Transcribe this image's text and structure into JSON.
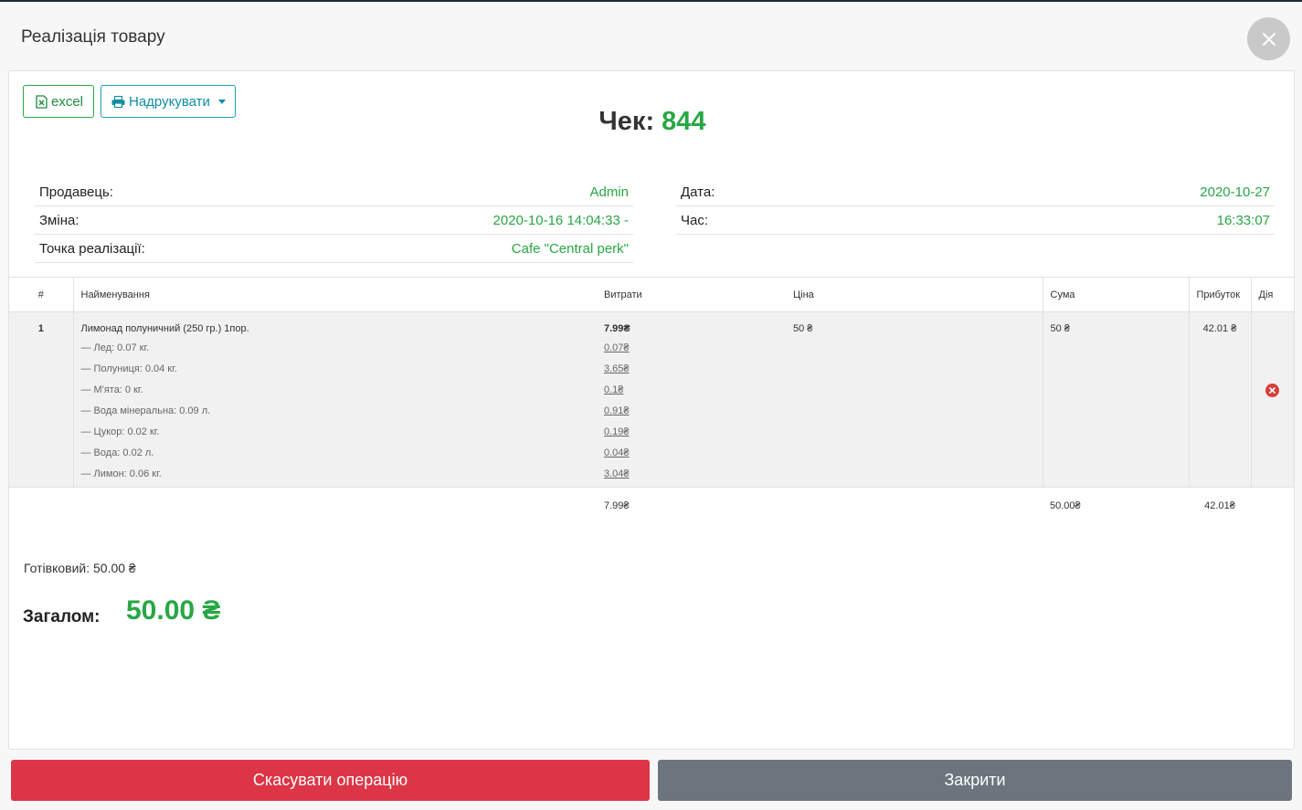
{
  "modal": {
    "title": "Реалізація товару"
  },
  "toolbar": {
    "excel_label": "excel",
    "print_label": "Надрукувати"
  },
  "receipt": {
    "label": "Чек:",
    "number": "844"
  },
  "info_left": [
    {
      "label": "Продавець:",
      "value": "Admin"
    },
    {
      "label": "Зміна:",
      "value": "2020-10-16 14:04:33 -"
    },
    {
      "label": "Точка реалізації:",
      "value": "Cafe \"Central perk\""
    }
  ],
  "info_right": [
    {
      "label": "Дата:",
      "value": "2020-10-27"
    },
    {
      "label": "Час:",
      "value": "16:33:07"
    }
  ],
  "table": {
    "headers": [
      "#",
      "Найменування",
      "Витрати",
      "Ціна",
      "Сума",
      "Прибуток",
      "Дія"
    ],
    "rows": [
      {
        "index": "1",
        "name": "Лимонад полуничний (250 гр.) 1пор.",
        "cost": "7.99₴",
        "price": "50 ₴",
        "sum": "50 ₴",
        "profit": "42.01 ₴",
        "ingredients": [
          {
            "name": "— Лед: 0.07 кг.",
            "cost": "0.07₴"
          },
          {
            "name": "— Полуниця: 0.04 кг.",
            "cost": "3.65₴"
          },
          {
            "name": "— М'ята: 0 кг.",
            "cost": "0.1₴"
          },
          {
            "name": "— Вода мінеральна: 0.09 л.",
            "cost": "0.91₴"
          },
          {
            "name": "— Цукор: 0.02 кг.",
            "cost": "0.19₴"
          },
          {
            "name": "— Вода: 0.02 л.",
            "cost": "0.04₴"
          },
          {
            "name": "— Лимон: 0.06 кг.",
            "cost": "3.04₴"
          }
        ]
      }
    ],
    "totals": {
      "cost": "7.99₴",
      "sum": "50.00₴",
      "profit": "42.01₴"
    }
  },
  "payment": {
    "cash": "Готівковий: 50.00 ₴"
  },
  "total": {
    "label": "Загалом:",
    "value": "50.00 ₴"
  },
  "footer": {
    "cancel_label": "Скасувати операцію",
    "close_label": "Закрити"
  },
  "colors": {
    "accent_green": "#28a745",
    "danger": "#dc3545",
    "secondary": "#6c757d",
    "info": "#17a2b8"
  }
}
